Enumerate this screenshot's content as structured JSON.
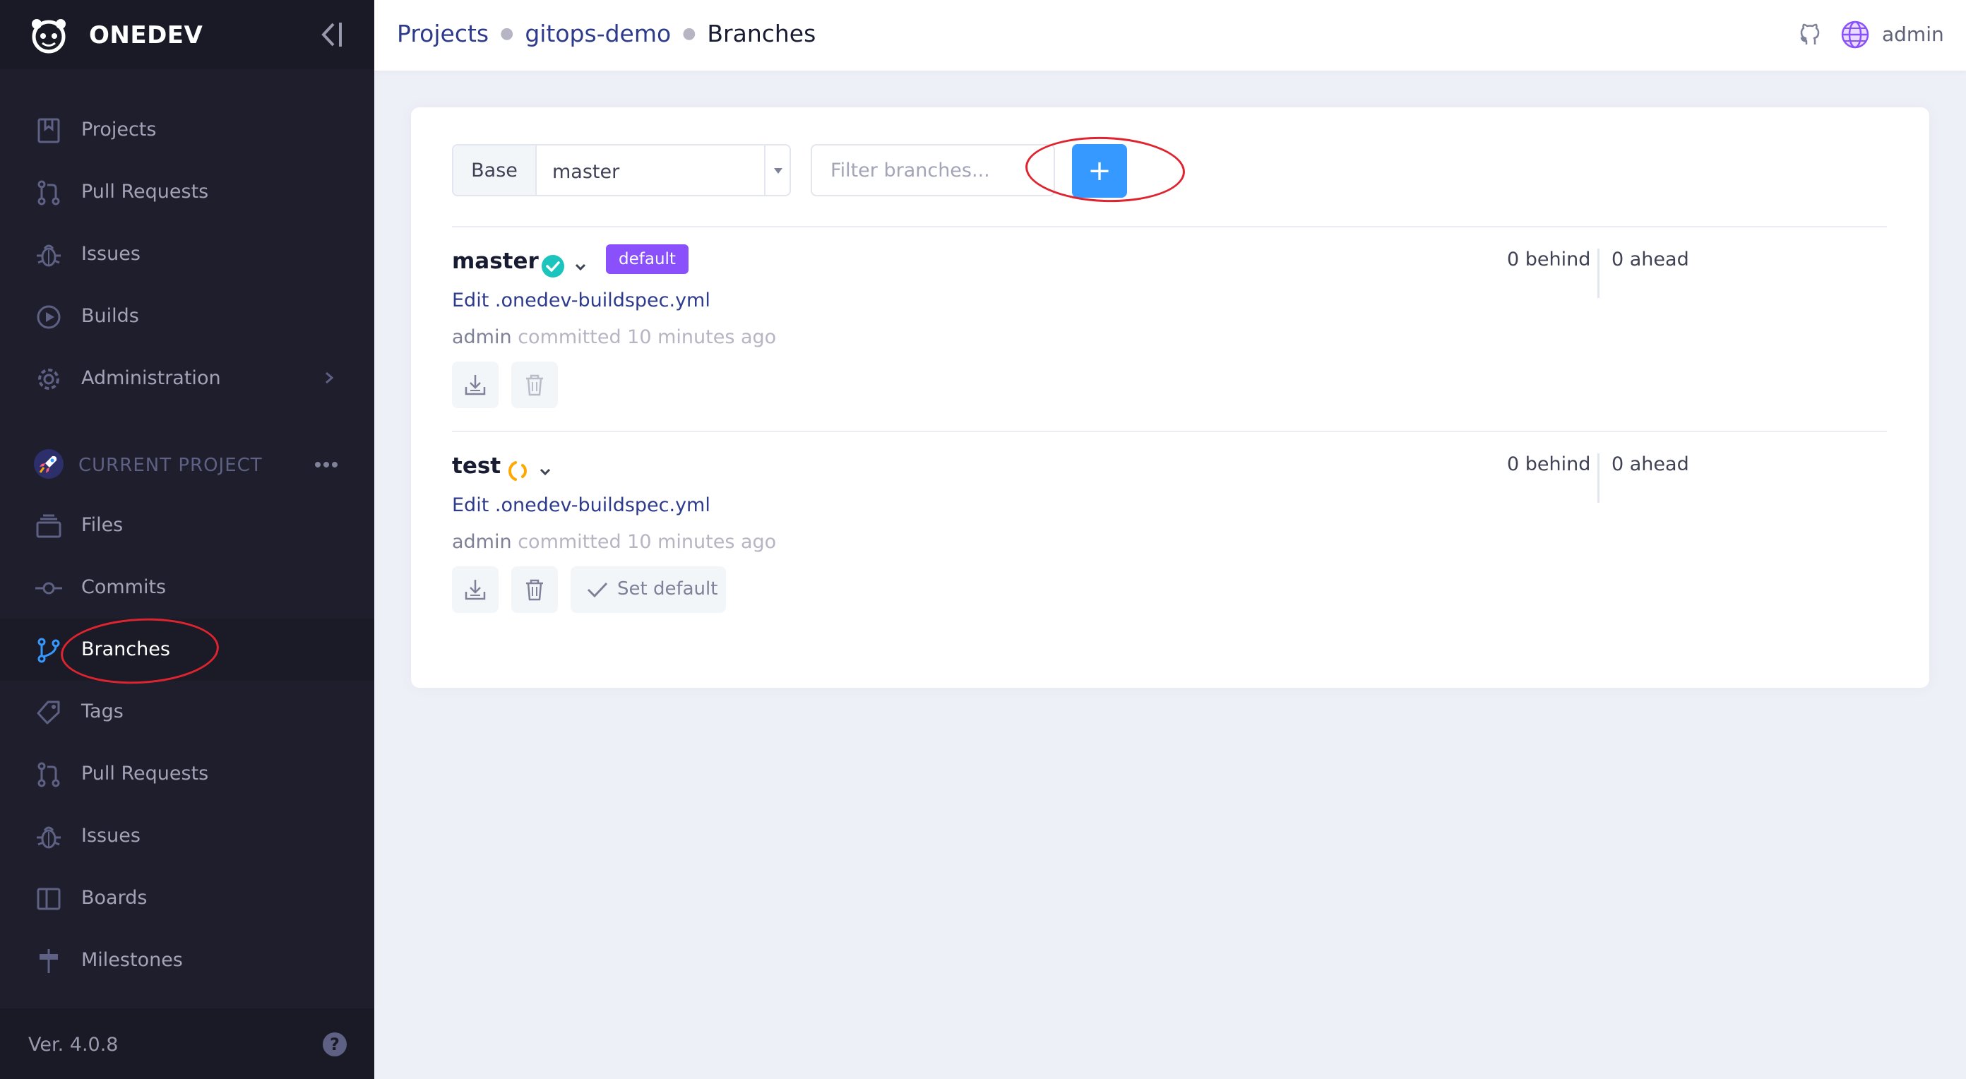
{
  "app": {
    "name": "ONEDEV"
  },
  "sidebar": {
    "global_items": [
      {
        "label": "Projects",
        "icon": "book-icon"
      },
      {
        "label": "Pull Requests",
        "icon": "pull-request-icon"
      },
      {
        "label": "Issues",
        "icon": "bug-icon"
      },
      {
        "label": "Builds",
        "icon": "play-circle-icon"
      },
      {
        "label": "Administration",
        "icon": "gear-icon"
      }
    ],
    "section_label": "CURRENT PROJECT",
    "project_items": [
      {
        "label": "Files",
        "icon": "stack-icon"
      },
      {
        "label": "Commits",
        "icon": "commit-icon"
      },
      {
        "label": "Branches",
        "icon": "branch-icon",
        "active": true
      },
      {
        "label": "Tags",
        "icon": "tag-icon"
      },
      {
        "label": "Pull Requests",
        "icon": "pull-request-icon"
      },
      {
        "label": "Issues",
        "icon": "bug-icon"
      },
      {
        "label": "Boards",
        "icon": "board-icon"
      },
      {
        "label": "Milestones",
        "icon": "signpost-icon"
      }
    ],
    "version": "Ver. 4.0.8",
    "help_icon": "?"
  },
  "header": {
    "breadcrumb": [
      "Projects",
      "gitops-demo",
      "Branches"
    ],
    "user": "admin"
  },
  "toolbar": {
    "base_label": "Base",
    "base_value": "master",
    "filter_placeholder": "Filter branches...",
    "add_label": "+"
  },
  "branches": [
    {
      "name": "master",
      "status": "success",
      "badge": "default",
      "message": "Edit .onedev-buildspec.yml",
      "author": "admin",
      "committed": "committed 10 minutes ago",
      "behind": "0 behind",
      "ahead": "0 ahead"
    },
    {
      "name": "test",
      "status": "running",
      "message": "Edit .onedev-buildspec.yml",
      "author": "admin",
      "committed": "committed 10 minutes ago",
      "behind": "0 behind",
      "ahead": "0 ahead",
      "set_default_label": "Set default"
    }
  ],
  "colors": {
    "sidebar_bg": "#1e1e2d",
    "accent_blue": "#3699ff",
    "badge_purple": "#8950fc",
    "success_teal": "#1bc5bd",
    "running_orange": "#ffa800",
    "annotation_red": "#e0242f"
  }
}
